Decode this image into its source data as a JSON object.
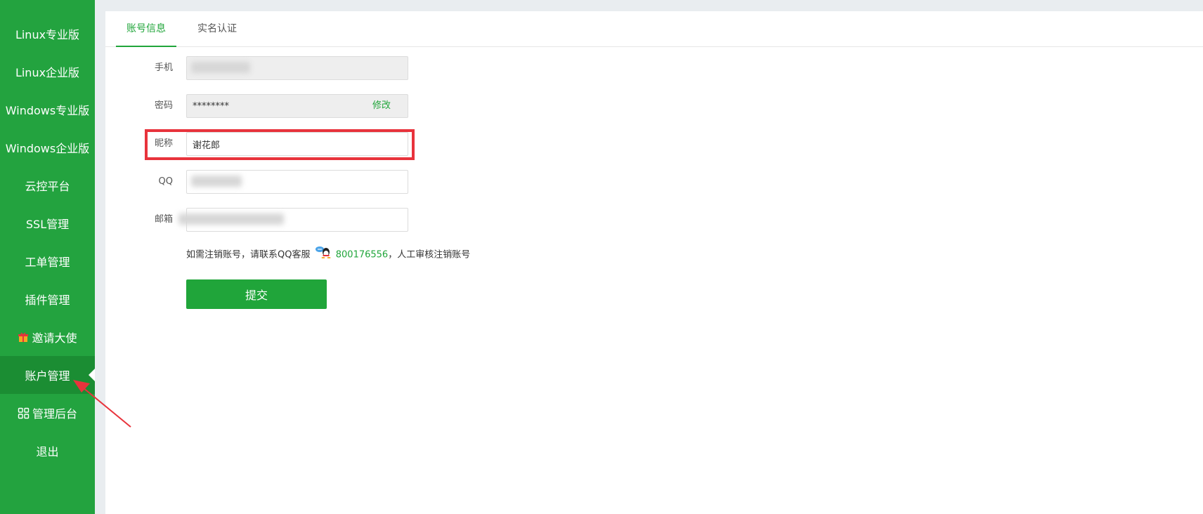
{
  "sidebar": {
    "items": [
      {
        "label": "Linux专业版"
      },
      {
        "label": "Linux企业版"
      },
      {
        "label": "Windows专业版"
      },
      {
        "label": "Windows企业版"
      },
      {
        "label": "云控平台"
      },
      {
        "label": "SSL管理"
      },
      {
        "label": "工单管理"
      },
      {
        "label": "插件管理"
      },
      {
        "label": "邀请大使",
        "icon": "gift-icon"
      },
      {
        "label": "账户管理",
        "active": true
      },
      {
        "label": "管理后台",
        "icon": "grid-icon"
      },
      {
        "label": "退出"
      }
    ]
  },
  "tabs": [
    {
      "label": "账号信息",
      "active": true
    },
    {
      "label": "实名认证"
    }
  ],
  "form": {
    "phone": {
      "label": "手机",
      "value": ""
    },
    "password": {
      "label": "密码",
      "value": "********",
      "edit_label": "修改"
    },
    "nickname": {
      "label": "昵称",
      "value": "谢花郎"
    },
    "qq": {
      "label": "QQ",
      "value": ""
    },
    "email": {
      "label": "邮箱",
      "value": ""
    },
    "note_prefix": "如需注销账号，请联系QQ客服",
    "note_qq": "800176556",
    "note_suffix": "，人工审核注销账号",
    "submit_label": "提交"
  },
  "colors": {
    "sidebar_bg": "#23a33f",
    "sidebar_active_bg": "#1b8d33",
    "accent": "#20a53a",
    "highlight": "#e8333c"
  }
}
